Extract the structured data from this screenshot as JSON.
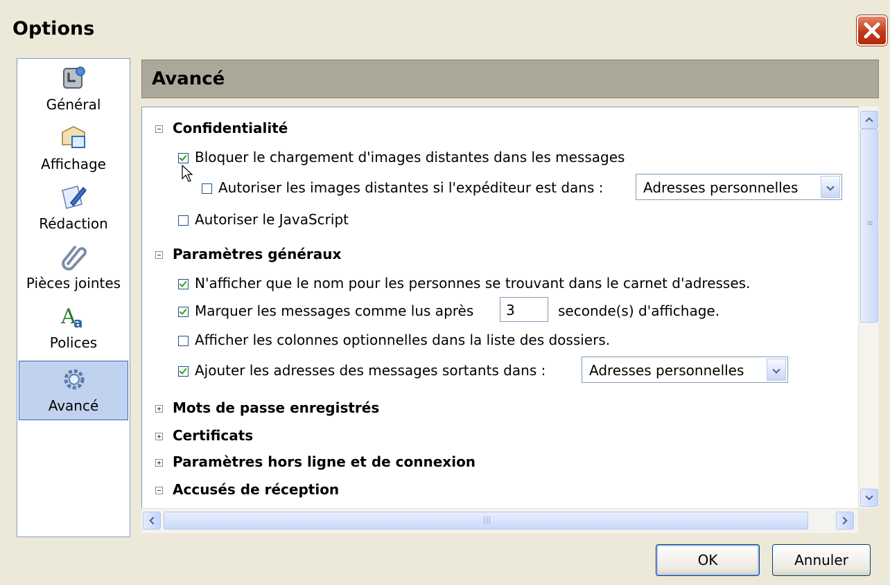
{
  "window": {
    "title": "Options"
  },
  "sidebar": {
    "items": [
      {
        "label": "Général",
        "icon": "general-settings-icon"
      },
      {
        "label": "Affichage",
        "icon": "display-icon"
      },
      {
        "label": "Rédaction",
        "icon": "compose-icon"
      },
      {
        "label": "Pièces jointes",
        "icon": "paperclip-icon"
      },
      {
        "label": "Polices",
        "icon": "fonts-icon"
      },
      {
        "label": "Avancé",
        "icon": "gears-icon",
        "selected": true
      }
    ]
  },
  "panel": {
    "title": "Avancé"
  },
  "sections": {
    "privacy": {
      "title": "Confidentialité",
      "block_images": {
        "label": "Bloquer le chargement d'images distantes dans les messages",
        "checked": true
      },
      "allow_images": {
        "label": "Autoriser les images distantes si l'expéditeur est dans :",
        "checked": false,
        "select_value": "Adresses personnelles"
      },
      "allow_js": {
        "label": "Autoriser le JavaScript",
        "checked": false
      }
    },
    "general": {
      "title": "Paramètres généraux",
      "name_only": {
        "label": "N'afficher que le nom pour les personnes se trouvant dans le carnet d'adresses.",
        "checked": true
      },
      "mark_read": {
        "label": "Marquer les messages comme lus après",
        "suffix": "seconde(s) d'affichage.",
        "value": "3",
        "checked": true
      },
      "optional_columns": {
        "label": "Afficher les colonnes optionnelles dans la liste des dossiers.",
        "checked": false
      },
      "add_addresses": {
        "label": "Ajouter les adresses des messages sortants dans :",
        "checked": true,
        "select_value": "Adresses personnelles"
      }
    },
    "passwords": {
      "title": "Mots de passe enregistrés"
    },
    "certificates": {
      "title": "Certificats"
    },
    "offline": {
      "title": "Paramètres hors ligne et de connexion"
    },
    "receipts": {
      "title": "Accusés de réception"
    }
  },
  "buttons": {
    "ok": "OK",
    "cancel": "Annuler"
  }
}
